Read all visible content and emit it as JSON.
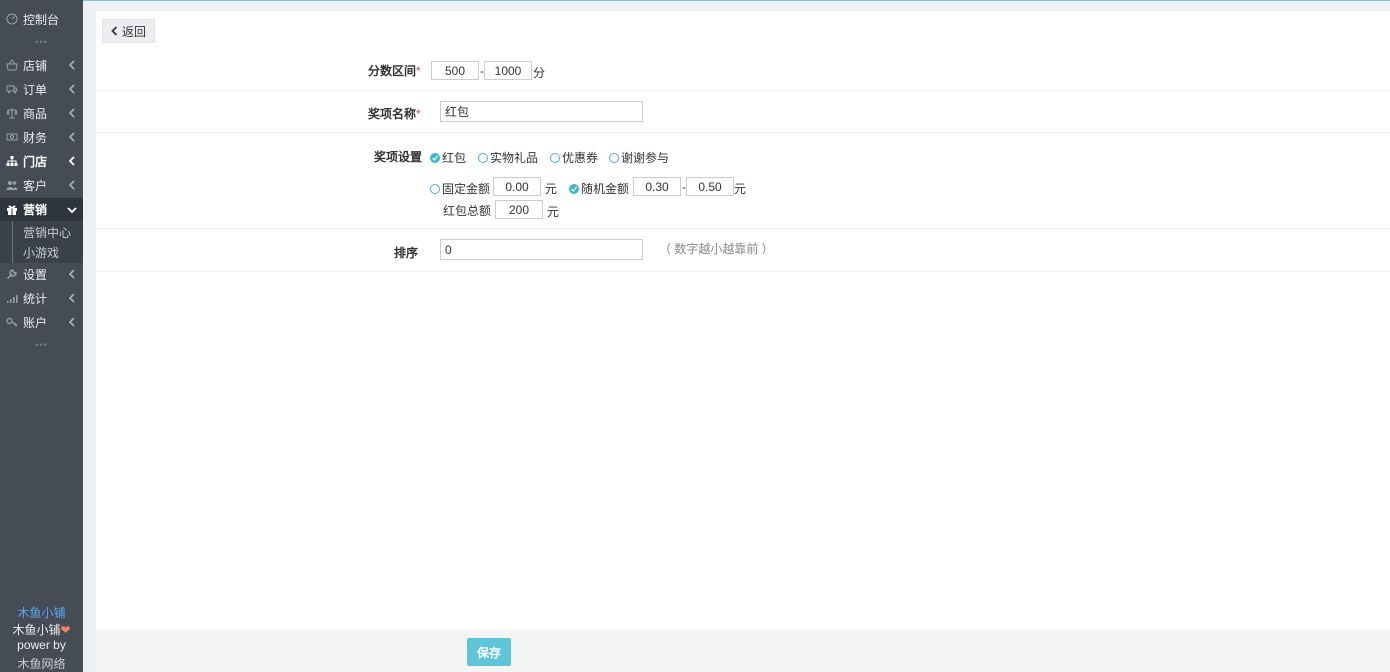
{
  "sidebar": {
    "dashboard": "控制台",
    "dots": "•••",
    "items": [
      {
        "label": "店铺",
        "icon": "basket-icon"
      },
      {
        "label": "订单",
        "icon": "truck-icon"
      },
      {
        "label": "商品",
        "icon": "scale-icon"
      },
      {
        "label": "财务",
        "icon": "cash-icon"
      },
      {
        "label": "门店",
        "icon": "sitemap-icon"
      },
      {
        "label": "客户",
        "icon": "users-icon"
      },
      {
        "label": "营销",
        "icon": "gift-icon"
      },
      {
        "label": "设置",
        "icon": "wrench-icon"
      },
      {
        "label": "统计",
        "icon": "signal-icon"
      },
      {
        "label": "账户",
        "icon": "key-icon"
      }
    ],
    "submenu": [
      "营销中心",
      "小游戏"
    ],
    "footer": {
      "brand_link": "木鱼小铺",
      "brand_heart": "木鱼小铺",
      "power_by": "power by",
      "company": "木鱼网络"
    }
  },
  "back_button": "返回",
  "form": {
    "score_range": {
      "label": "分数区间",
      "min": "500",
      "max": "1000",
      "unit": "分",
      "dash": "-"
    },
    "prize_name": {
      "label": "奖项名称",
      "value": "红包"
    },
    "prize_setting": {
      "label": "奖项设置",
      "types": [
        {
          "label": "红包",
          "checked": true
        },
        {
          "label": "实物礼品",
          "checked": false
        },
        {
          "label": "优惠券",
          "checked": false
        },
        {
          "label": "谢谢参与",
          "checked": false
        }
      ],
      "fixed_amount": {
        "label": "固定金额",
        "value": "0.00",
        "unit": "元",
        "checked": false
      },
      "random_amount": {
        "label": "随机金额",
        "min": "0.30",
        "max": "0.50",
        "unit": "元",
        "checked": true,
        "dash": "-"
      },
      "total": {
        "label": "红包总额",
        "value": "200",
        "unit": "元"
      }
    },
    "sort": {
      "label": "排序",
      "value": "0",
      "hint": "（ 数字越小越靠前 ）"
    },
    "required_mark": "*"
  },
  "save_button": "保存",
  "colors": {
    "sidebar": "#464c56",
    "accent": "#5fc6d9",
    "radio": "#3fb5d1",
    "link": "#5aa9f0"
  }
}
